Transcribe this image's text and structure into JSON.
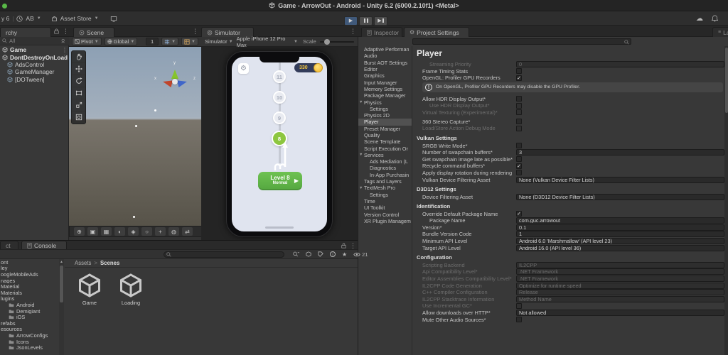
{
  "window": {
    "title": "Game - ArrowOut - Android - Unity 6.2 (6000.2.10f1) <Metal>"
  },
  "toolbar": {
    "version_fragment": "y 6",
    "account_label": "AB",
    "asset_store_label": "Asset Store"
  },
  "tabs": {
    "hierarchy_fragment": "rchy",
    "scene": "Scene",
    "simulator": "Simulator",
    "inspector": "Inspector",
    "project_settings": "Project Settings",
    "layout_fragment": "La"
  },
  "hierarchy": {
    "search_label": "All",
    "items": [
      {
        "label": "Game",
        "type": "scene"
      },
      {
        "label": "DontDestroyOnLoad",
        "type": "scene"
      },
      {
        "label": "AdsControl",
        "type": "object"
      },
      {
        "label": "GameManager",
        "type": "object"
      },
      {
        "label": "[DOTween]",
        "type": "object"
      }
    ]
  },
  "scene_toolbar": {
    "pivot": "Pivot",
    "global": "Global",
    "grid_value": "1"
  },
  "scene_tools": [
    "hand-tool-icon",
    "move-tool-icon",
    "rotate-tool-icon",
    "rect-tool-icon",
    "scale-tool-icon",
    "transform-tool-icon"
  ],
  "scene_footer_icons": [
    {
      "name": "pan-icon",
      "glyph": "⊕"
    },
    {
      "name": "camera-icon",
      "glyph": "▣"
    },
    {
      "name": "textures-icon",
      "glyph": "▦"
    },
    {
      "name": "globe-icon",
      "glyph": "◐"
    },
    {
      "name": "layers-icon",
      "glyph": "◈"
    },
    {
      "name": "zoom-icon",
      "glyph": "○"
    },
    {
      "name": "move-icon",
      "glyph": "+"
    },
    {
      "name": "sprites-icon",
      "glyph": "◍"
    },
    {
      "name": "shuffle-icon",
      "glyph": "⇄"
    }
  ],
  "gizmo": {
    "x": "x",
    "y": "y",
    "z": "z"
  },
  "simulator": {
    "menu_label": "Simulator",
    "device": "Apple iPhone 12 Pro Max",
    "scale_label": "Scale"
  },
  "game": {
    "coins": "330",
    "nodes": [
      {
        "value": "11",
        "state": "normal"
      },
      {
        "value": "10",
        "state": "normal"
      },
      {
        "value": "9",
        "state": "normal"
      },
      {
        "value": "8",
        "state": "current"
      }
    ],
    "level_button": {
      "title": "Level 8",
      "subtitle": "Normal"
    }
  },
  "settings_nav": {
    "items": [
      {
        "label": "Adaptive Performan"
      },
      {
        "label": "Audio"
      },
      {
        "label": "Burst AOT Settings"
      },
      {
        "label": "Editor"
      },
      {
        "label": "Graphics"
      },
      {
        "label": "Input Manager"
      },
      {
        "label": "Memory Settings"
      },
      {
        "label": "Package Manager"
      },
      {
        "label": "Physics",
        "fold": true
      },
      {
        "label": "Settings",
        "indent": true
      },
      {
        "label": "Physics 2D"
      },
      {
        "label": "Player",
        "selected": true
      },
      {
        "label": "Preset Manager"
      },
      {
        "label": "Quality"
      },
      {
        "label": "Scene Template"
      },
      {
        "label": "Script Execution Or"
      },
      {
        "label": "Services",
        "fold": true
      },
      {
        "label": "Ads Mediation (L",
        "indent": true
      },
      {
        "label": "Diagnostics",
        "indent": true
      },
      {
        "label": "In-App Purchasin",
        "indent": true
      },
      {
        "label": "Tags and Layers"
      },
      {
        "label": "TextMesh Pro",
        "fold": true
      },
      {
        "label": "Settings",
        "indent": true
      },
      {
        "label": "Time"
      },
      {
        "label": "UI Toolkit"
      },
      {
        "label": "Version Control"
      },
      {
        "label": "XR Plugin Managem"
      }
    ]
  },
  "player": {
    "title": "Player",
    "blocks": [
      {
        "type": "row",
        "label": "Streaming Priority",
        "control": "field",
        "value": "0",
        "disabled": true,
        "indent": true
      },
      {
        "type": "row",
        "label": "Frame Timing Stats",
        "control": "checkbox",
        "checked": false
      },
      {
        "type": "row",
        "label": "OpenGL: Profiler GPU Recorders",
        "control": "checkbox",
        "checked": true
      },
      {
        "type": "warning",
        "text": "On OpenGL, Profiler GPU Recorders may disable the GPU Profiler."
      },
      {
        "type": "gap"
      },
      {
        "type": "row",
        "label": "Allow HDR Display Output*",
        "control": "checkbox",
        "checked": false
      },
      {
        "type": "row",
        "label": "Use HDR Display Output*",
        "control": "checkbox",
        "checked": false,
        "disabled": true,
        "indent": true
      },
      {
        "type": "row",
        "label": "Virtual Texturing (Experimental)*",
        "control": "checkbox",
        "checked": false,
        "disabled": true
      },
      {
        "type": "gap"
      },
      {
        "type": "row",
        "label": "360 Stereo Capture*",
        "control": "checkbox",
        "checked": false
      },
      {
        "type": "row",
        "label": "Load/Store Action Debug Mode",
        "control": "checkbox",
        "checked": false,
        "disabled": true
      },
      {
        "type": "gap"
      },
      {
        "type": "section",
        "label": "Vulkan Settings"
      },
      {
        "type": "row",
        "label": "SRGB Write Mode*",
        "control": "checkbox",
        "checked": false
      },
      {
        "type": "row",
        "label": "Number of swapchain buffers*",
        "control": "field",
        "value": "3"
      },
      {
        "type": "row",
        "label": "Get swapchain image late as possible*",
        "control": "checkbox",
        "checked": false
      },
      {
        "type": "row",
        "label": "Recycle command buffers*",
        "control": "checkbox",
        "checked": true
      },
      {
        "type": "row",
        "label": "Apply display rotation during rendering",
        "control": "checkbox",
        "checked": false
      },
      {
        "type": "row",
        "label": "Vulkan Device Filtering Asset",
        "control": "field",
        "value": "None (Vulkan Device Filter Lists)"
      },
      {
        "type": "gap"
      },
      {
        "type": "section",
        "label": "D3D12 Settings"
      },
      {
        "type": "row",
        "label": "Device Filtering Asset",
        "control": "field",
        "value": "None (D3D12 Device Filter Lists)"
      },
      {
        "type": "gap"
      },
      {
        "type": "section",
        "label": "Identification"
      },
      {
        "type": "row",
        "label": "Override Default Package Name",
        "control": "checkbox",
        "checked": true
      },
      {
        "type": "row",
        "label": "Package Name",
        "control": "field",
        "value": "com.guc.arrowout",
        "indent": true
      },
      {
        "type": "row",
        "label": "Version*",
        "control": "field",
        "value": "0.1"
      },
      {
        "type": "row",
        "label": "Bundle Version Code",
        "control": "field",
        "value": "1"
      },
      {
        "type": "row",
        "label": "Minimum API Level",
        "control": "field",
        "value": "Android 6.0 'Marshmallow' (API level 23)"
      },
      {
        "type": "row",
        "label": "Target API Level",
        "control": "field",
        "value": "Android 16.0 (API level 36)"
      },
      {
        "type": "gap"
      },
      {
        "type": "section",
        "label": "Configuration"
      },
      {
        "type": "row",
        "label": "Scripting Backend",
        "control": "field",
        "value": "IL2CPP",
        "disabled": true
      },
      {
        "type": "row",
        "label": "Api Compatibility Level*",
        "control": "field",
        "value": ".NET Framework",
        "disabled": true
      },
      {
        "type": "row",
        "label": "Editor Assemblies Compatibility Level*",
        "control": "field",
        "value": ".NET Framework",
        "disabled": true
      },
      {
        "type": "row",
        "label": "IL2CPP Code Generation",
        "control": "field",
        "value": "Optimize for runtime speed",
        "disabled": true
      },
      {
        "type": "row",
        "label": "C++ Compiler Configuration",
        "control": "field",
        "value": "Release",
        "disabled": true
      },
      {
        "type": "row",
        "label": "IL2CPP Stacktrace Information",
        "control": "field",
        "value": "Method Name",
        "disabled": true
      },
      {
        "type": "row",
        "label": "Use Incremental GC*",
        "control": "checkbox",
        "checked": false,
        "disabled": true
      },
      {
        "type": "row",
        "label": "Allow downloads over HTTP*",
        "control": "field",
        "value": "Not allowed"
      },
      {
        "type": "row",
        "label": "Mute Other Audio Sources*",
        "control": "checkbox",
        "checked": false
      }
    ]
  },
  "console": {
    "project_tab_fragment": "ct",
    "console_tab": "Console",
    "visible_count": "21"
  },
  "project": {
    "breadcrumb": {
      "root": "Assets",
      "separator": ">",
      "current": "Scenes"
    },
    "tree": [
      {
        "label": "ont"
      },
      {
        "label": "ley"
      },
      {
        "label": "oogleMobileAds"
      },
      {
        "label": "nages"
      },
      {
        "label": "Material"
      },
      {
        "label": "Materials"
      },
      {
        "label": "lugins"
      },
      {
        "label": "Android",
        "indent": true,
        "folder": true
      },
      {
        "label": "Demigiant",
        "indent": true,
        "folder": true
      },
      {
        "label": "iOS",
        "indent": true,
        "folder": true
      },
      {
        "label": "refabs"
      },
      {
        "label": "esources"
      },
      {
        "label": "ArrowConfigs",
        "indent": true,
        "folder": true
      },
      {
        "label": "Icons",
        "indent": true,
        "folder": true
      },
      {
        "label": "JsonLevels",
        "indent": true,
        "folder": true
      }
    ],
    "assets": [
      {
        "label": "Game"
      },
      {
        "label": "Loading"
      }
    ]
  },
  "colors": {
    "play_active": "#40597a",
    "level_green": "#8dc63f",
    "button_green": "#5cb84c",
    "coin_gold": "#f3c53d",
    "screen_bg": "#e0e4ef",
    "panel_bg": "#383838",
    "selection_gray": "#515151"
  }
}
